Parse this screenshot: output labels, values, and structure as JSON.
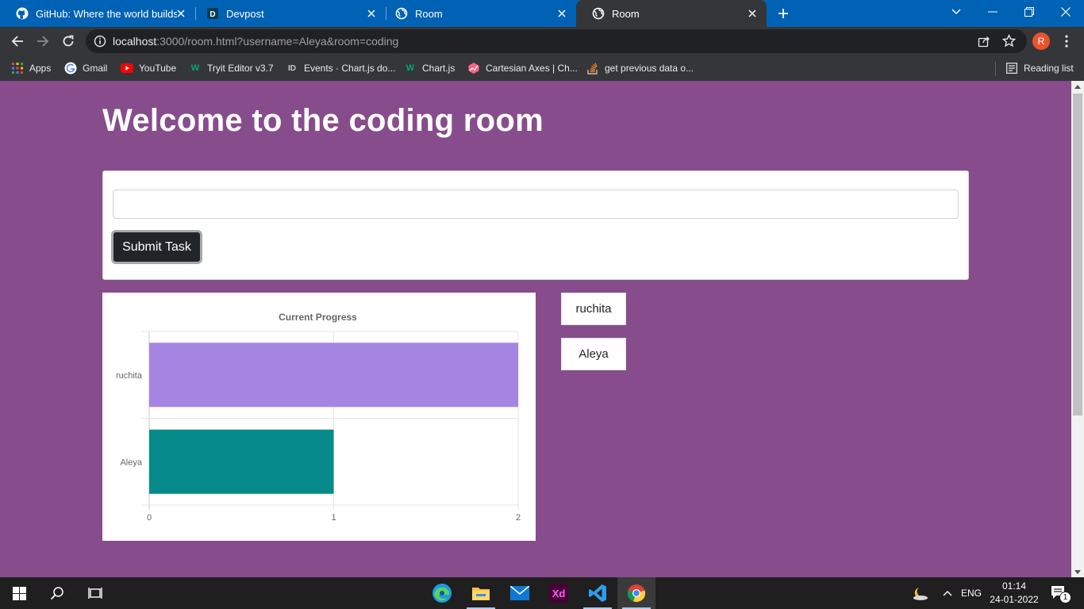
{
  "browser": {
    "tabs": [
      {
        "title": "GitHub: Where the world builds s",
        "icon": "github-icon"
      },
      {
        "title": "Devpost",
        "icon": "devpost-icon"
      },
      {
        "title": "Room",
        "icon": "globe-icon"
      },
      {
        "title": "Room",
        "icon": "globe-icon",
        "active": true
      }
    ],
    "url_host": "localhost",
    "url_rest": ":3000/room.html?username=Aleya&room=coding",
    "profile_initial": "R",
    "bookmarks": [
      {
        "label": "Apps",
        "icon": "apps-grid-icon"
      },
      {
        "label": "Gmail",
        "icon": "google-icon"
      },
      {
        "label": "YouTube",
        "icon": "youtube-icon"
      },
      {
        "label": "Tryit Editor v3.7",
        "icon": "w3schools-icon"
      },
      {
        "label": "Events · Chart.js do...",
        "icon": "chartjs-docs-icon"
      },
      {
        "label": "Chart.js",
        "icon": "w3schools-icon"
      },
      {
        "label": "Cartesian Axes | Ch...",
        "icon": "chartjs-icon"
      },
      {
        "label": "get previous data o...",
        "icon": "stackoverflow-icon"
      }
    ],
    "reading_list": "Reading list"
  },
  "page": {
    "heading": "Welcome to the coding room",
    "task_input": {
      "value": "",
      "placeholder": ""
    },
    "submit_label": "Submit Task",
    "users": [
      "ruchita",
      "Aleya"
    ]
  },
  "chart_data": {
    "type": "bar",
    "orientation": "horizontal",
    "title": "Current Progress",
    "categories": [
      "ruchita",
      "Aleya"
    ],
    "values": [
      2,
      1
    ],
    "colors": [
      "#a685e2",
      "#068b8a"
    ],
    "xlim": [
      0,
      2
    ],
    "xticks": [
      "0",
      "1",
      "2"
    ],
    "grid": true,
    "legend": "none"
  },
  "taskbar": {
    "language": "ENG",
    "time": "01:14",
    "date": "24-01-2022",
    "notification_count": "1",
    "apps": [
      "edge-icon",
      "file-explorer-icon",
      "mail-icon",
      "adobe-xd-icon",
      "vscode-icon",
      "chrome-icon"
    ]
  }
}
